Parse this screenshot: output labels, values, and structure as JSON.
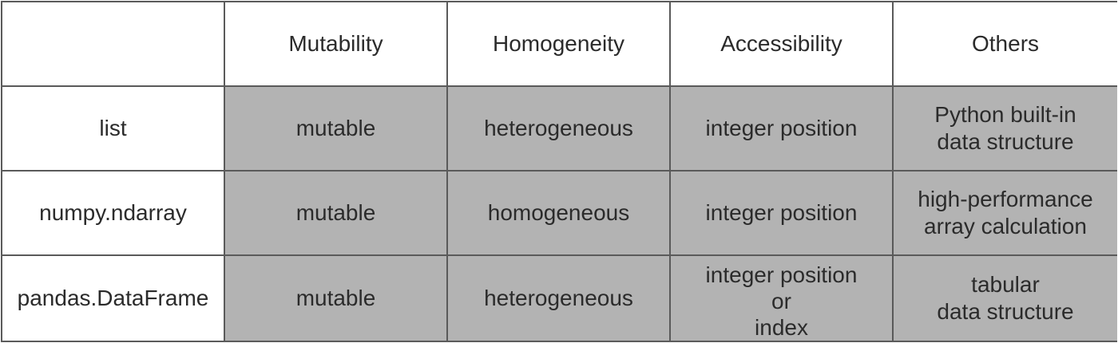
{
  "table": {
    "headers": [
      "",
      "Mutability",
      "Homogeneity",
      "Accessibility",
      "Others"
    ],
    "rows": [
      {
        "name": "list",
        "mutability": "mutable",
        "homogeneity": "heterogeneous",
        "accessibility": "integer position",
        "others": "Python built-in\ndata structure"
      },
      {
        "name": "numpy.ndarray",
        "mutability": "mutable",
        "homogeneity": "homogeneous",
        "accessibility": "integer position",
        "others": "high-performance\narray calculation"
      },
      {
        "name": "pandas.DataFrame",
        "mutability": "mutable",
        "homogeneity": "heterogeneous",
        "accessibility": "integer position\nor\nindex",
        "others": "tabular\ndata structure"
      }
    ]
  },
  "colors": {
    "data_cell_bg": "#b3b3b3",
    "border": "#5a5a5a",
    "text": "#2b2b2b"
  }
}
